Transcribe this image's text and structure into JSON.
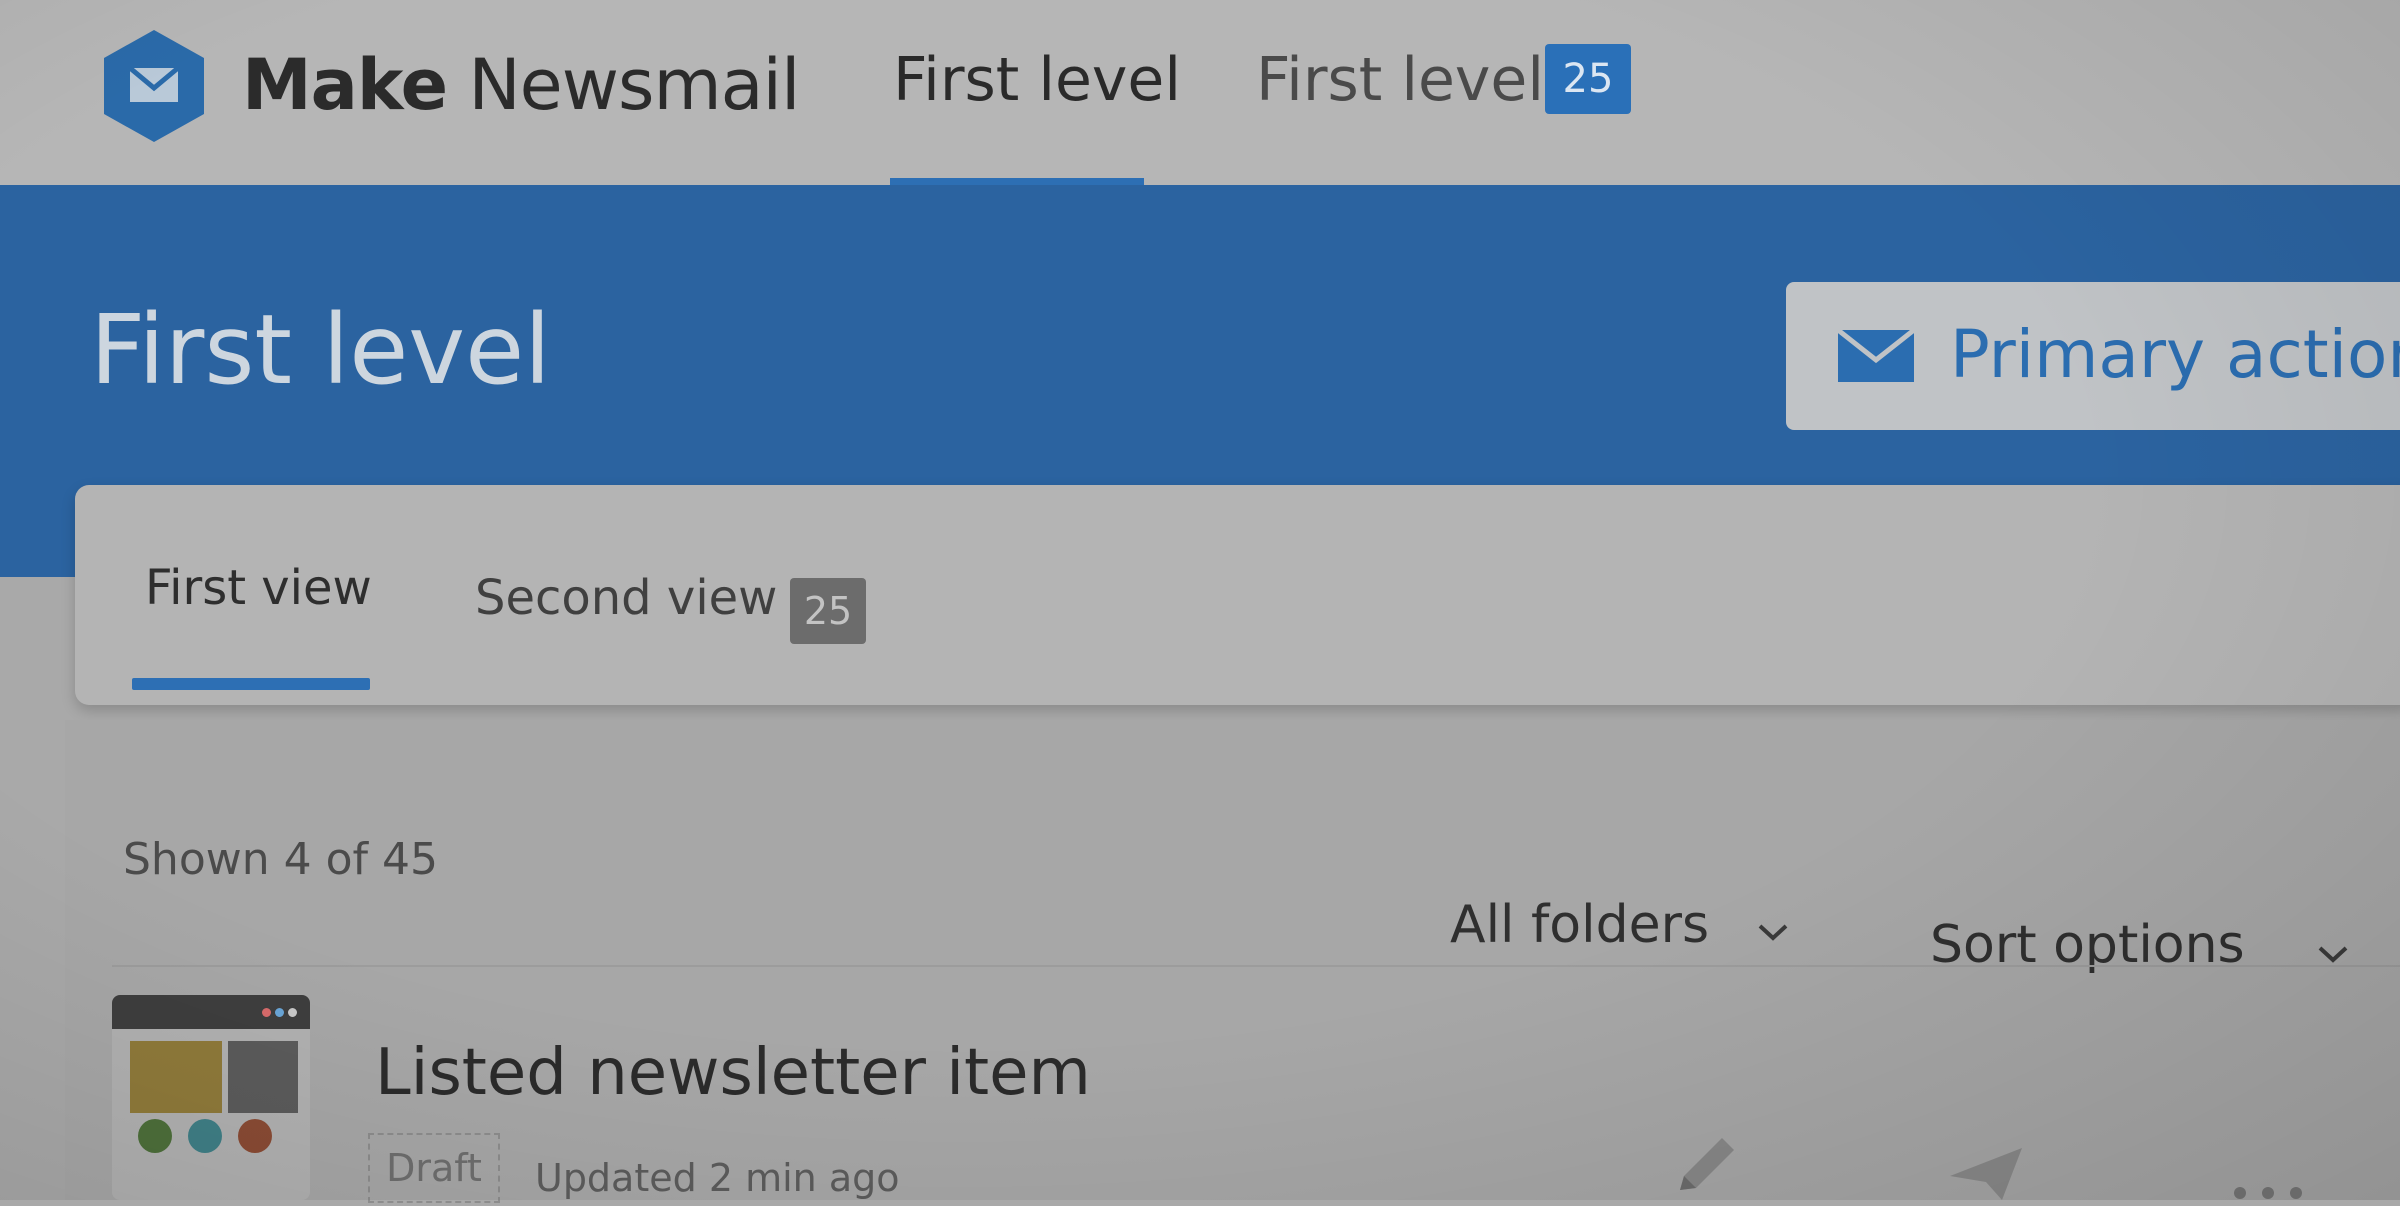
{
  "header": {
    "brand_bold": "Make",
    "brand_light": "Newsmail",
    "nav": [
      {
        "label": "First level",
        "active": true
      },
      {
        "label": "First level",
        "badge": "25"
      }
    ]
  },
  "hero": {
    "title": "First level",
    "primary_action": "Primary action"
  },
  "views": {
    "tabs": [
      {
        "label": "First view",
        "active": true
      },
      {
        "label": "Second view",
        "badge": "25"
      }
    ]
  },
  "list": {
    "shown_text": "Shown 4 of 45",
    "filters": {
      "folders": "All folders",
      "sort": "Sort options"
    },
    "items": [
      {
        "title": "Listed newsletter item",
        "status": "Draft",
        "updated": "Updated 2 min ago"
      }
    ]
  },
  "colors": {
    "accent": "#2d6fb4",
    "hero_bg": "#2b63a0",
    "badge_grey": "#6c6c6c"
  },
  "icons": [
    "logo-envelope-hexagon-icon",
    "envelope-icon",
    "chevron-down-icon",
    "pencil-icon",
    "send-icon",
    "more-icon"
  ]
}
